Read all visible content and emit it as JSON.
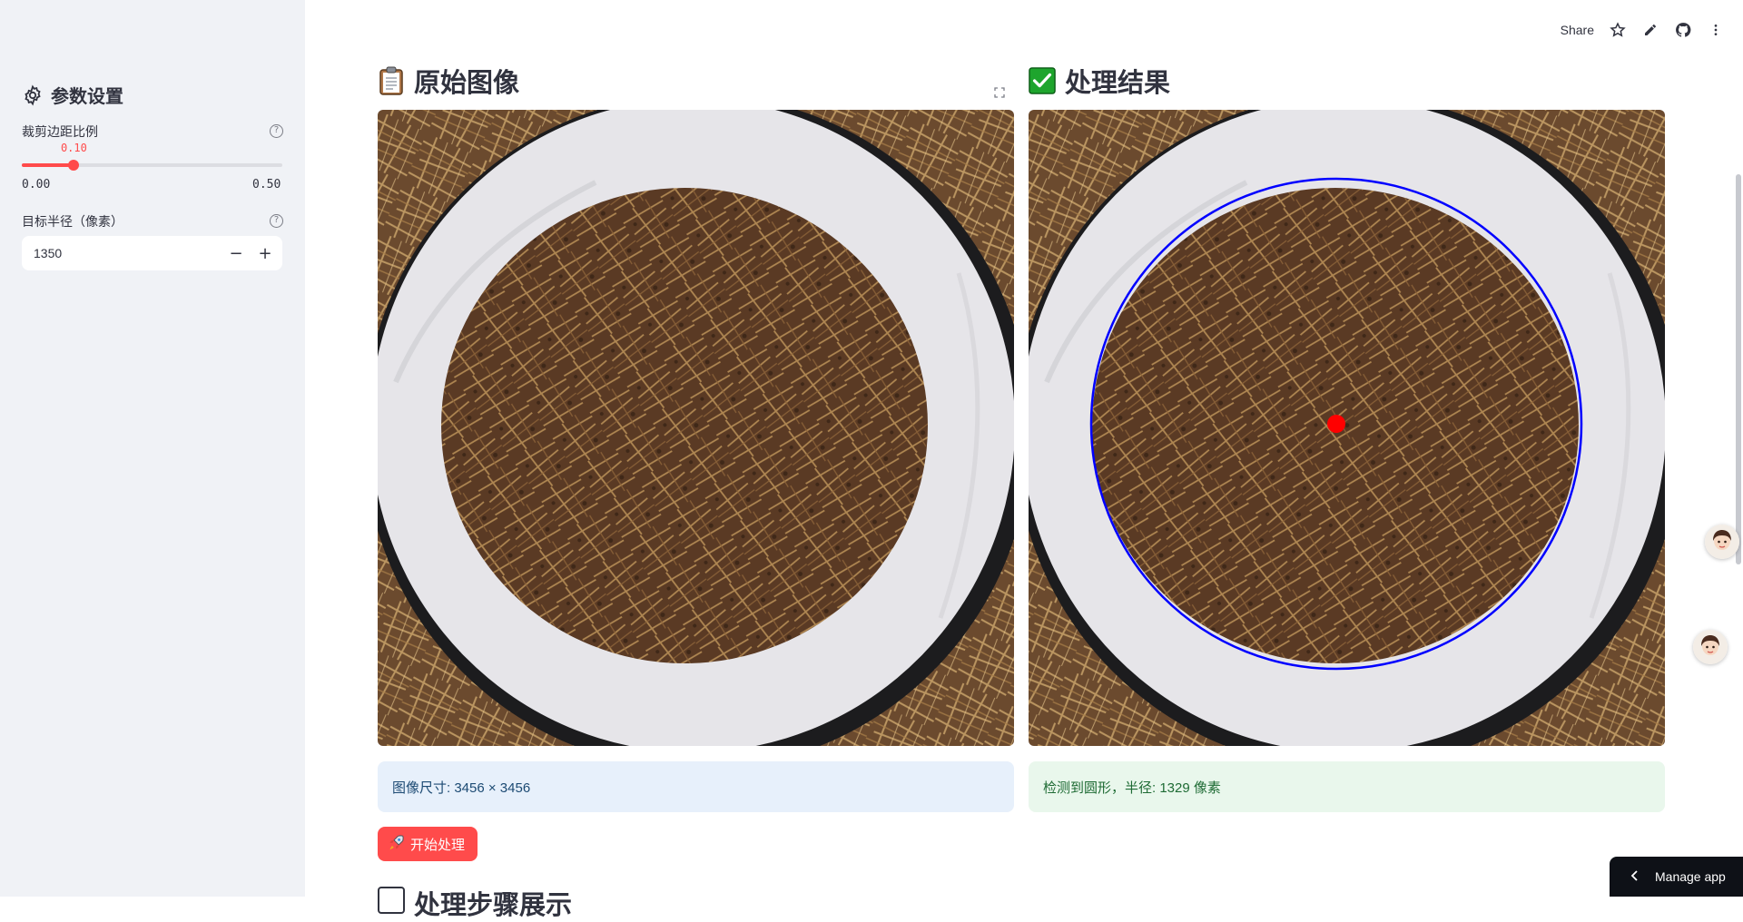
{
  "sidebar": {
    "title": "参数设置",
    "title_icon": "gear-icon",
    "slider": {
      "label": "裁剪边距比例",
      "value": "0.10",
      "value_num": 0.1,
      "min": "0.00",
      "max": "0.50",
      "min_num": 0.0,
      "max_num": 0.5
    },
    "radius": {
      "label": "目标半径（像素）",
      "value": "1350",
      "minus": "−",
      "plus": "+"
    }
  },
  "toolbar": {
    "share_label": "Share",
    "icons": [
      "star-icon",
      "edit-icon",
      "github-icon",
      "more-vertical-icon"
    ]
  },
  "main": {
    "left": {
      "title": "原始图像",
      "title_icon": "clipboard-icon",
      "info": "图像尺寸: 3456 × 3456"
    },
    "right": {
      "title": "处理结果",
      "title_icon": "check-mark-icon",
      "info": "检测到圆形，半径: 1329 像素"
    },
    "start_button": "开始处理",
    "start_icon": "rocket-icon",
    "next_section_title": "处理步骤展示"
  },
  "manage_app": "Manage app",
  "colors": {
    "accent": "#ff4b4b",
    "sidebar_bg": "#f0f2f6",
    "info_blue_bg": "#e7f0fb",
    "info_green_bg": "#e9f7ec",
    "detected_circle": "#0000ff",
    "center_dot": "#ff0000"
  }
}
